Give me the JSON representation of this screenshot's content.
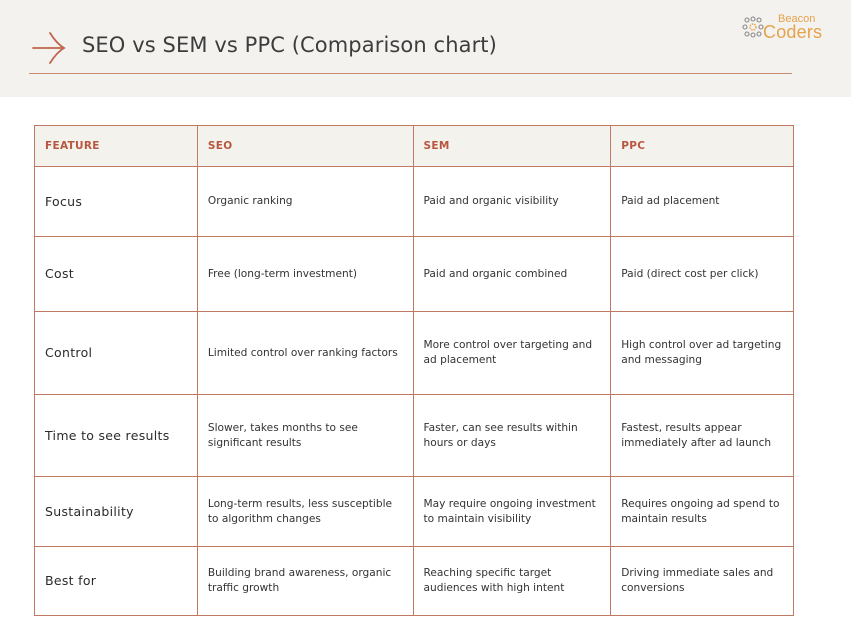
{
  "header": {
    "title": "SEO vs SEM vs PPC (Comparison chart)",
    "accent_color": "#c0654c",
    "logo": {
      "top_text": "Beacon",
      "bottom_text": "Coders",
      "color": "#e6a24d"
    }
  },
  "table": {
    "columns": [
      "FEATURE",
      "SEO",
      "SEM",
      "PPC"
    ],
    "rows": [
      {
        "feature": "Focus",
        "seo": "Organic ranking",
        "sem": "Paid and organic visibility",
        "ppc": "Paid ad placement"
      },
      {
        "feature": "Cost",
        "seo": "Free (long-term investment)",
        "sem": "Paid and organic combined",
        "ppc": "Paid (direct cost per click)"
      },
      {
        "feature": "Control",
        "seo": "Limited control over ranking factors",
        "sem": "More control over targeting and ad placement",
        "ppc": "High control over ad targeting and messaging"
      },
      {
        "feature": "Time to see results",
        "seo": "Slower, takes months to see significant results",
        "sem": "Faster, can see results within hours or days",
        "ppc": "Fastest, results appear immediately after ad launch"
      },
      {
        "feature": "Sustainability",
        "seo": "Long-term results, less susceptible to algorithm changes",
        "sem": "May require ongoing investment to maintain visibility",
        "ppc": "Requires ongoing ad spend to maintain results"
      },
      {
        "feature": "Best for",
        "seo": "Building brand awareness, organic traffic growth",
        "sem": "Reaching specific target audiences with high intent",
        "ppc": "Driving immediate sales and conversions"
      }
    ]
  }
}
